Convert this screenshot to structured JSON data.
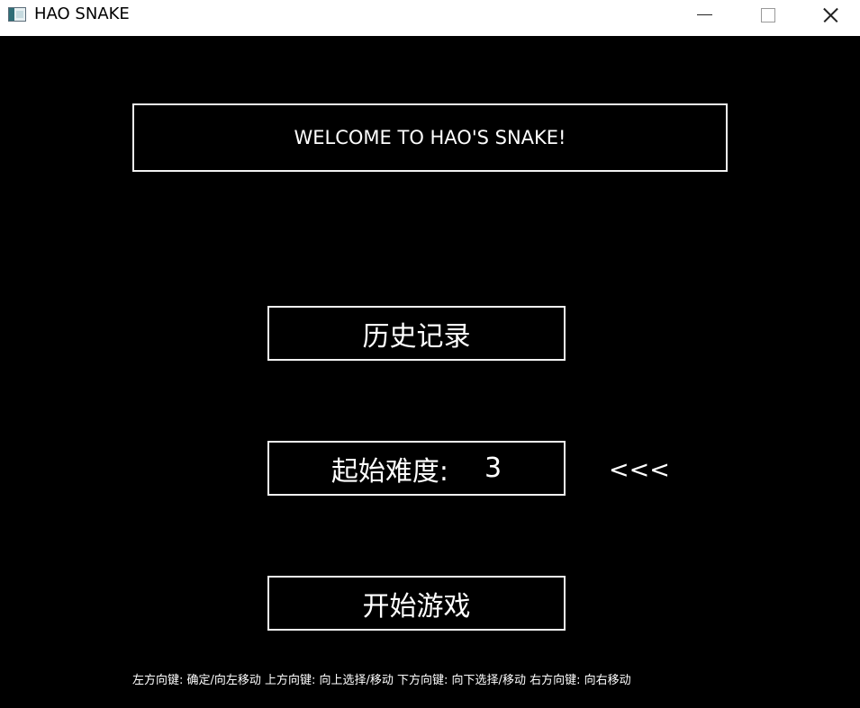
{
  "window": {
    "title": "HAO SNAKE",
    "icon": "app-window-icon"
  },
  "welcome": {
    "text": "WELCOME TO HAO'S SNAKE!"
  },
  "menu": {
    "history_label": "历史记录",
    "difficulty_label": "起始难度:",
    "difficulty_value": "3",
    "start_label": "开始游戏",
    "selection_cursor": "<<<"
  },
  "instructions": {
    "text": "左方向键: 确定/向左移动  上方向键: 向上选择/移动  下方向键: 向下选择/移动  右方向键: 向右移动"
  },
  "colors": {
    "background": "#000000",
    "foreground": "#ffffff",
    "titlebar": "#ffffff"
  }
}
